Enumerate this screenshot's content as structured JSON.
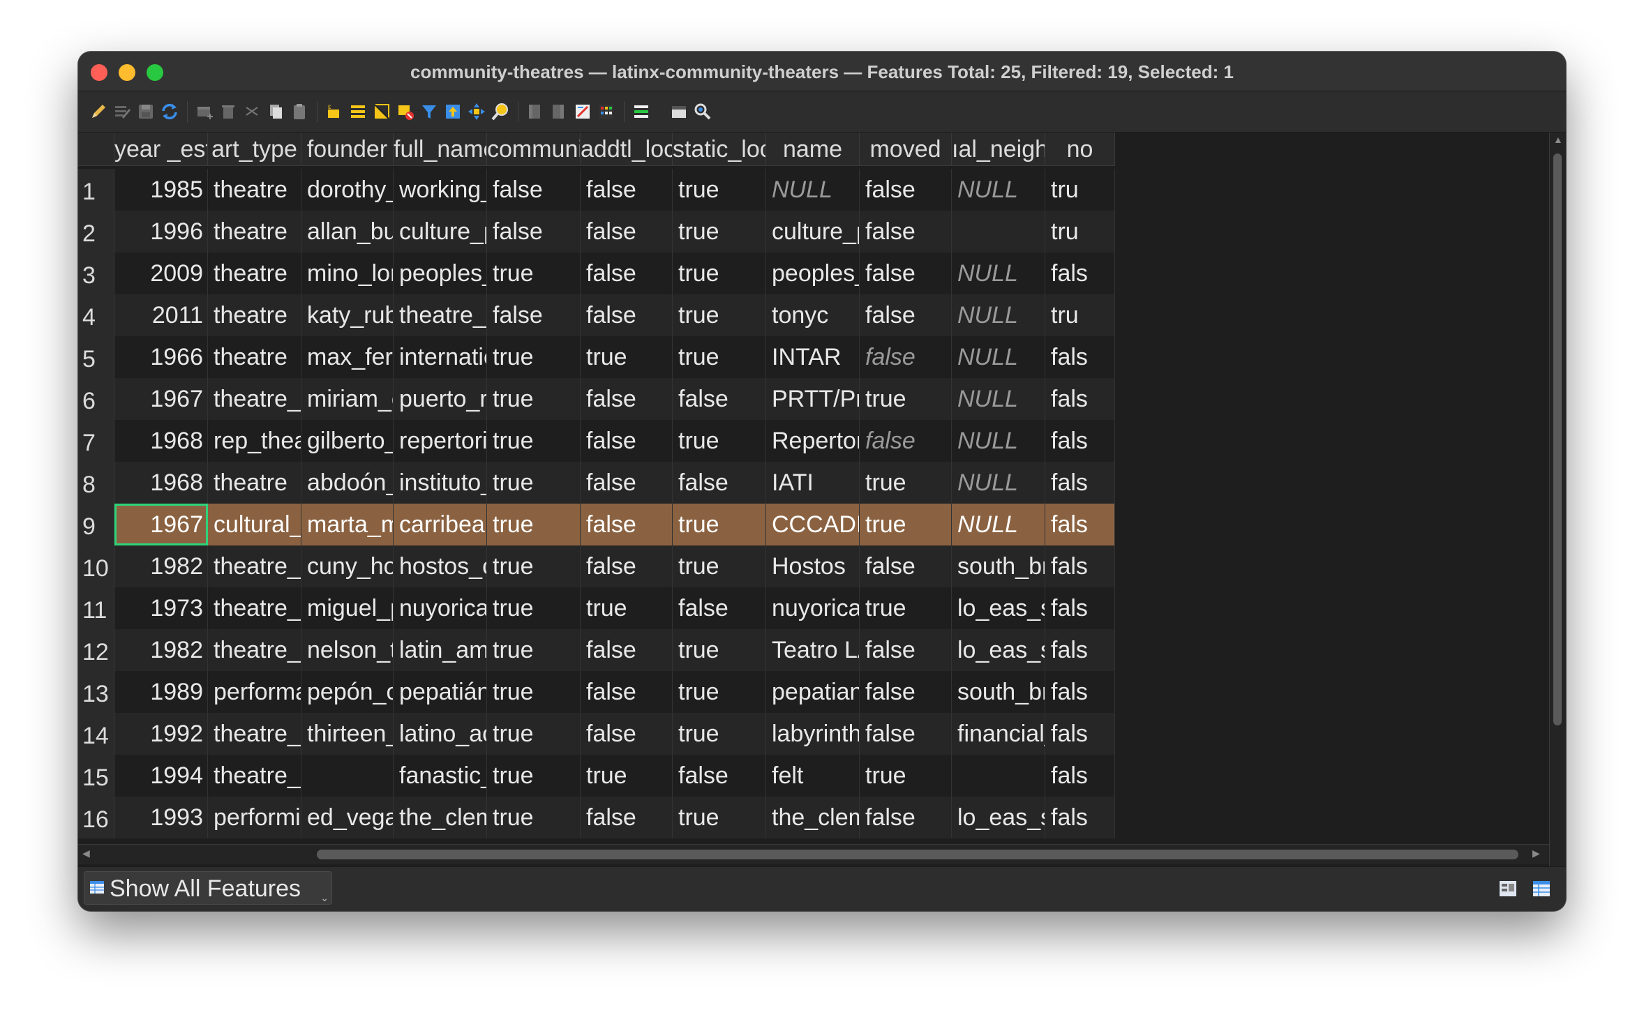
{
  "window": {
    "title": "community-theatres — latinx-community-theaters — Features Total: 25, Filtered: 19, Selected: 1"
  },
  "toolbar": {
    "icons": [
      "pencil-icon",
      "multi-edit-icon",
      "save-icon",
      "reload-icon",
      "add-feature-icon",
      "delete-feature-icon",
      "cut-icon",
      "copy-icon",
      "paste-icon",
      "select-by-expression-icon",
      "select-all-icon",
      "invert-selection-icon",
      "deselect-all-icon",
      "filter-icon",
      "move-selection-top-icon",
      "pan-to-selection-icon",
      "zoom-to-selection-icon",
      "new-field-icon",
      "delete-field-icon",
      "field-calculator-icon",
      "conditional-formatting-icon",
      "actions-icon",
      "dock-icon",
      "search-icon"
    ]
  },
  "table": {
    "columns": [
      "year _est",
      "art_type",
      "founder",
      "full_name",
      "community_",
      "addtl_locs",
      "static_loc",
      "name",
      "moved",
      "ıal_neighbor",
      "no"
    ],
    "rows": [
      {
        "num": "1",
        "cells": [
          "1985",
          "theatre",
          "dorothy_f...",
          "working_...",
          "false",
          "false",
          "true",
          "NULL",
          "false",
          "NULL",
          "tru"
        ]
      },
      {
        "num": "2",
        "cells": [
          "1996",
          "theatre",
          "allan_buc...",
          "culture_p...",
          "false",
          "false",
          "true",
          "culture_p...",
          "false",
          "",
          "tru"
        ]
      },
      {
        "num": "3",
        "cells": [
          "2009",
          "theatre",
          "mino_lor...",
          "peoples_...",
          "true",
          "false",
          "true",
          "peoples_...",
          "false",
          "NULL",
          "fals"
        ]
      },
      {
        "num": "4",
        "cells": [
          "2011",
          "theatre",
          "katy_rubin",
          "theatre_o...",
          "false",
          "false",
          "true",
          "tonyc",
          "false",
          "NULL",
          "tru"
        ]
      },
      {
        "num": "5",
        "cells": [
          "1966",
          "theatre",
          "max_ferrá",
          "internatio...",
          "true",
          "true",
          "true",
          "INTAR",
          "false",
          "NULL",
          "fals"
        ]
      },
      {
        "num": "6",
        "cells": [
          "1967",
          "theatre_t...",
          "miriam_c...",
          "puerto_ri...",
          "true",
          "false",
          "false",
          "PRTT/Pre...",
          "true",
          "NULL",
          "fals"
        ]
      },
      {
        "num": "7",
        "cells": [
          "1968",
          "rep_theat...",
          "gilberto_z...",
          "repertorio...",
          "true",
          "false",
          "true",
          "Repertorio",
          "false",
          "NULL",
          "fals"
        ]
      },
      {
        "num": "8",
        "cells": [
          "1968",
          "theatre",
          "abdoón_...",
          "instituto_...",
          "true",
          "false",
          "false",
          "IATI",
          "true",
          "NULL",
          "fals"
        ]
      },
      {
        "num": "9",
        "cells": [
          "1967",
          "cultural_...",
          "marta_m...",
          "carribean...",
          "true",
          "false",
          "true",
          "CCCADI",
          "true",
          "NULL",
          "fals"
        ]
      },
      {
        "num": "10",
        "cells": [
          "1982",
          "theatre_c...",
          "cuny_hos...",
          "hostos_c...",
          "true",
          "false",
          "true",
          "Hostos",
          "false",
          "south_br...",
          "fals"
        ]
      },
      {
        "num": "11",
        "cells": [
          "1973",
          "theatre_p...",
          "miguel_pi...",
          "nuyorica...",
          "true",
          "true",
          "false",
          "nuyorica...",
          "true",
          "lo_eas_si",
          "fals"
        ]
      },
      {
        "num": "12",
        "cells": [
          "1982",
          "theatre_s...",
          "nelson_t...",
          "latin_ame...",
          "true",
          "false",
          "true",
          "Teatro LA...",
          "false",
          "lo_eas_si",
          "fals"
        ]
      },
      {
        "num": "13",
        "cells": [
          "1989",
          "performa...",
          "pepón_o...",
          "pepatián...",
          "true",
          "false",
          "true",
          "pepatian",
          "false",
          "south_br...",
          "fals"
        ]
      },
      {
        "num": "14",
        "cells": [
          "1992",
          "theatre_lab",
          "thirteen_...",
          "latino_act...",
          "true",
          "false",
          "true",
          "labyrinth...",
          "false",
          "financial_...",
          "fals"
        ]
      },
      {
        "num": "15",
        "cells": [
          "1994",
          "theatre_lab",
          "",
          "fanastic_...",
          "true",
          "true",
          "false",
          "felt",
          "true",
          "",
          "fals"
        ]
      },
      {
        "num": "16",
        "cells": [
          "1993",
          "performi...",
          "ed_vega...",
          "the_clem...",
          "true",
          "false",
          "true",
          "the_clem...",
          "false",
          "lo_eas_si",
          "fals"
        ]
      }
    ],
    "italic_cells": [
      [
        0,
        7
      ],
      [
        0,
        9
      ],
      [
        2,
        9
      ],
      [
        3,
        9
      ],
      [
        4,
        8
      ],
      [
        4,
        9
      ],
      [
        5,
        9
      ],
      [
        6,
        8
      ],
      [
        6,
        9
      ],
      [
        7,
        9
      ],
      [
        8,
        9
      ]
    ],
    "selected_row": 8
  },
  "statusbar": {
    "filter_label": "Show All Features"
  },
  "colors": {
    "selection": "#8b6241",
    "focus": "#2fd37a"
  }
}
